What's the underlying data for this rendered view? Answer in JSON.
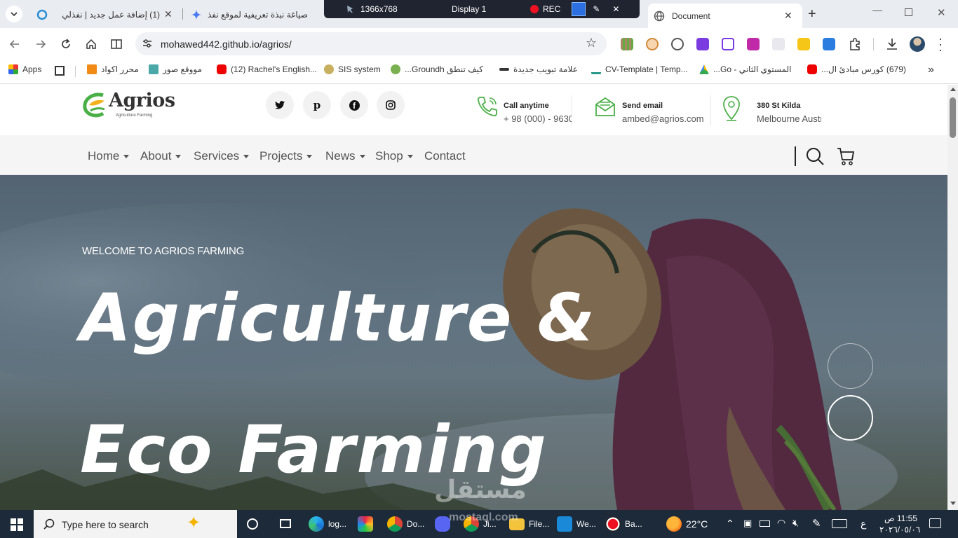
{
  "tabs": [
    {
      "title": "(1) إضافة عمل جديد | نفذلي"
    },
    {
      "title": "صياغة نبذة تعريفية لموقع نفذ"
    },
    {
      "title": "Document"
    }
  ],
  "recorder": {
    "resolution": "1366x768",
    "display": "Display 1",
    "rec_label": "REC"
  },
  "address": {
    "url": "mohawed442.github.io/agrios/"
  },
  "bookmarks": [
    {
      "label": "Apps"
    },
    {
      "label": "محرر اكواد"
    },
    {
      "label": "مووقع صور"
    },
    {
      "label": "(12) Rachel's English..."
    },
    {
      "label": "SIS system"
    },
    {
      "label": "كيف تنطق Groundh..."
    },
    {
      "label": "علامة تبويب جديدة"
    },
    {
      "label": "CV-Template | Temp..."
    },
    {
      "label": "المستوي الثاني - Go..."
    },
    {
      "label": "(679) كورس مبادئ ال..."
    }
  ],
  "site": {
    "logo_text": "Agrios",
    "logo_tagline": "Agriculture Farming",
    "contacts": [
      {
        "title": "Call anytime",
        "value": "+ 98 (000) - 9630"
      },
      {
        "title": "Send email",
        "value": "ambed@agrios.com"
      },
      {
        "title": "380 St Kilda",
        "value": "Melbourne Austr"
      }
    ],
    "nav": [
      {
        "label": "Home",
        "dropdown": true
      },
      {
        "label": "About",
        "dropdown": true
      },
      {
        "label": "Services",
        "dropdown": true
      },
      {
        "label": "Projects",
        "dropdown": true
      },
      {
        "label": "News",
        "dropdown": true
      },
      {
        "label": "Shop",
        "dropdown": true
      },
      {
        "label": "Contact",
        "dropdown": false
      }
    ],
    "hero": {
      "welcome": "WELCOME TO AGRIOS FARMING",
      "line1": "Agriculture &",
      "line2": "Eco Farming"
    },
    "colors": {
      "brand_green": "#4baf47",
      "nav_text": "#555555"
    }
  },
  "watermark": {
    "text": "مستقل",
    "sub": "mostaql.com"
  },
  "taskbar": {
    "search_placeholder": "Type here to search",
    "apps": [
      {
        "label": "log..."
      },
      {
        "label": "Do..."
      },
      {
        "label": "Ji..."
      },
      {
        "label": "File..."
      },
      {
        "label": "We..."
      },
      {
        "label": "Ba..."
      }
    ],
    "weather": "22°C",
    "lang": "ع",
    "time": "11:55 ص",
    "date": "٢٠٢٦/٠٥/٠٦"
  }
}
